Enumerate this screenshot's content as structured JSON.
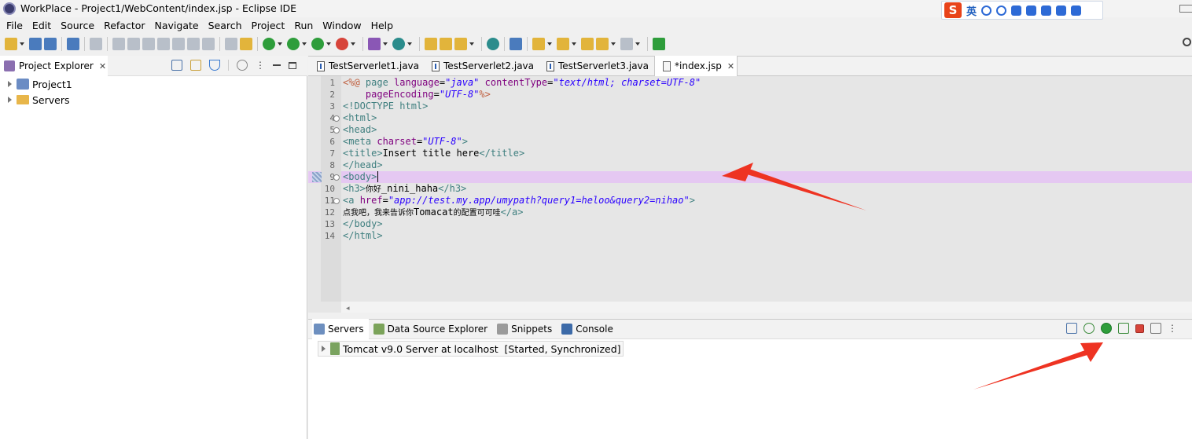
{
  "window": {
    "title": "WorkPlace - Project1/WebContent/index.jsp - Eclipse IDE",
    "ime_label": "英"
  },
  "menu": [
    "File",
    "Edit",
    "Source",
    "Refactor",
    "Navigate",
    "Search",
    "Project",
    "Run",
    "Window",
    "Help"
  ],
  "explorer": {
    "tab_label": "Project Explorer",
    "items": [
      {
        "label": "Project1",
        "icon": "project-icon"
      },
      {
        "label": "Servers",
        "icon": "folder-icon"
      }
    ]
  },
  "editor": {
    "tabs": [
      {
        "label": "TestServerlet1.java",
        "icon": "java-file-icon",
        "active": false
      },
      {
        "label": "TestServerlet2.java",
        "icon": "java-file-icon",
        "active": false
      },
      {
        "label": "TestServerlet3.java",
        "icon": "java-file-icon",
        "active": false
      },
      {
        "label": "*index.jsp",
        "icon": "jsp-file-icon",
        "active": true
      }
    ],
    "line_numbers": [
      "1",
      "2",
      "3",
      "4",
      "5",
      "6",
      "7",
      "8",
      "9",
      "10",
      "11",
      "12",
      "13",
      "14"
    ],
    "highlighted_line": 9,
    "lines": [
      [
        [
          "d",
          "<%@ "
        ],
        [
          "k",
          "page "
        ],
        [
          "a",
          "language"
        ],
        [
          "t",
          "="
        ],
        [
          "s",
          "\"java\""
        ],
        [
          "t",
          " "
        ],
        [
          "a",
          "contentType"
        ],
        [
          "t",
          "="
        ],
        [
          "s",
          "\"text/html; charset=UTF-8\""
        ]
      ],
      [
        [
          "t",
          "    "
        ],
        [
          "a",
          "pageEncoding"
        ],
        [
          "t",
          "="
        ],
        [
          "s",
          "\"UTF-8\""
        ],
        [
          "d",
          "%>"
        ]
      ],
      [
        [
          "k",
          "<!DOCTYPE html>"
        ]
      ],
      [
        [
          "k",
          "<html>"
        ]
      ],
      [
        [
          "k",
          "<head>"
        ]
      ],
      [
        [
          "k",
          "<meta "
        ],
        [
          "a",
          "charset"
        ],
        [
          "t",
          "="
        ],
        [
          "s",
          "\"UTF-8\""
        ],
        [
          "k",
          ">"
        ]
      ],
      [
        [
          "k",
          "<title>"
        ],
        [
          "t",
          "Insert title here"
        ],
        [
          "k",
          "</title>"
        ]
      ],
      [
        [
          "k",
          "</head>"
        ]
      ],
      [
        [
          "k",
          "<body>"
        ]
      ],
      [
        [
          "k",
          "<h3>"
        ],
        [
          "cjk",
          "你好"
        ],
        [
          "t",
          "_nini_haha"
        ],
        [
          "k",
          "</h3>"
        ]
      ],
      [
        [
          "k",
          "<a "
        ],
        [
          "a",
          "href"
        ],
        [
          "t",
          "="
        ],
        [
          "s",
          "\"app://test.my.app/umypath?query1=heloo&query2=nihao\""
        ],
        [
          "k",
          ">"
        ]
      ],
      [
        [
          "cjk",
          "点我吧，我来告诉你"
        ],
        [
          "t",
          "Tomacat"
        ],
        [
          "cjk",
          "的配置可可哇"
        ],
        [
          "k",
          "</a>"
        ]
      ],
      [
        [
          "k",
          "</body>"
        ]
      ],
      [
        [
          "k",
          "</html>"
        ]
      ]
    ]
  },
  "bottom": {
    "tabs": [
      {
        "label": "Servers",
        "icon": "servers-icon",
        "active": true
      },
      {
        "label": "Data Source Explorer",
        "icon": "data-source-icon",
        "active": false
      },
      {
        "label": "Snippets",
        "icon": "snippets-icon",
        "active": false
      },
      {
        "label": "Console",
        "icon": "console-icon",
        "active": false
      }
    ],
    "server_entry": "Tomcat v9.0 Server at localhost  [Started, Synchronized]"
  },
  "colors": {
    "highlight_line": "#e5c8f2",
    "arrow_red": "#ee3322",
    "tag": "#3f7f7f",
    "attribute": "#7f007f",
    "string": "#2a00ff"
  }
}
